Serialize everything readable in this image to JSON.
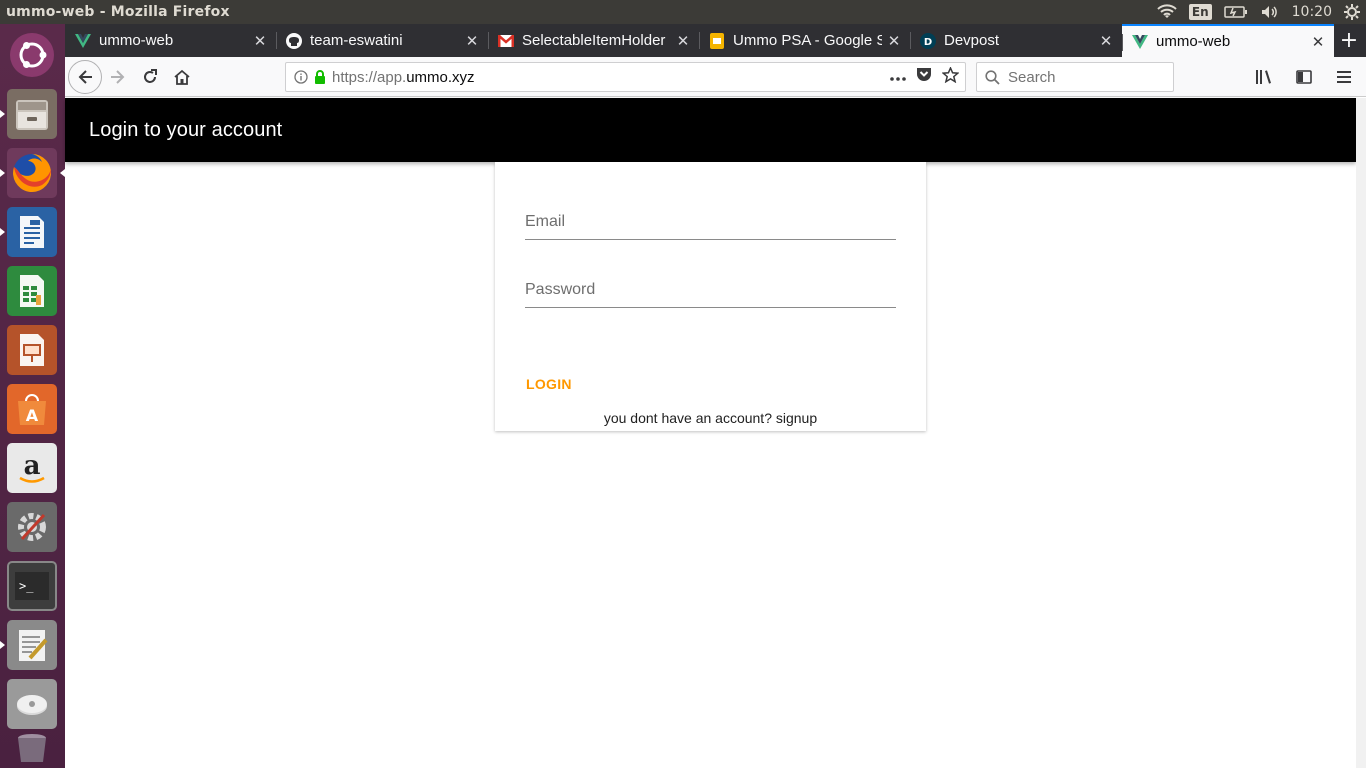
{
  "window": {
    "title": "ummo-web - Mozilla Firefox"
  },
  "system_panel": {
    "language": "En",
    "time": "10:20"
  },
  "launcher": {
    "items": [
      "ubuntu-dash-icon",
      "files-icon",
      "firefox-icon",
      "writer-icon",
      "calc-icon",
      "impress-icon",
      "software-center-icon",
      "amazon-icon",
      "system-settings-icon",
      "terminal-icon",
      "text-editor-icon",
      "disks-icon",
      "trash-icon"
    ]
  },
  "tabs": [
    {
      "label": "ummo-web",
      "icon": "vue-icon"
    },
    {
      "label": "team-eswatini",
      "icon": "github-icon"
    },
    {
      "label": "SelectableItemHolder",
      "icon": "gmail-icon"
    },
    {
      "label": "Ummo PSA - Google Sl",
      "icon": "slides-icon"
    },
    {
      "label": "Devpost",
      "icon": "devpost-icon"
    },
    {
      "label": "ummo-web",
      "icon": "vue-icon",
      "active": true
    }
  ],
  "nav": {
    "url_prefix": "https://app.",
    "url_host": "ummo.xyz",
    "search_placeholder": "Search"
  },
  "app": {
    "title": "Login to your account",
    "email_placeholder": "Email",
    "email_value": "",
    "password_placeholder": "Password",
    "password_value": "",
    "login_label": "LOGIN",
    "signup_prefix": "you dont have an account? ",
    "signup_link": "signup",
    "accent_color": "#ff9800",
    "toolbar_color": "#000000"
  }
}
